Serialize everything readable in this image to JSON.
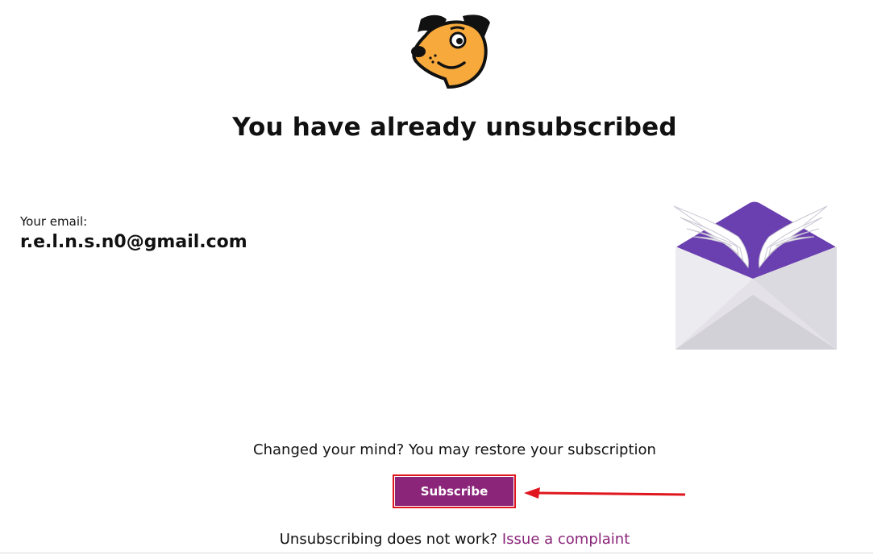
{
  "header": {
    "logo_icon": "dog-mascot-icon",
    "title": "You have already unsubscribed"
  },
  "account": {
    "email_label": "Your email:",
    "email_value": "r.e.l.n.s.n0@gmail.com"
  },
  "illustration": {
    "icon": "winged-envelope-icon"
  },
  "restore": {
    "prompt": "Changed your mind? You may restore your subscription",
    "subscribe_label": "Subscribe"
  },
  "footer": {
    "question": "Unsubscribing does not work?",
    "complaint_link": "Issue a complaint"
  },
  "colors": {
    "accent": "#8a2579",
    "highlight": "#e0161e",
    "envelope_purple": "#6a3fb0",
    "mascot_orange": "#f7a93c"
  }
}
